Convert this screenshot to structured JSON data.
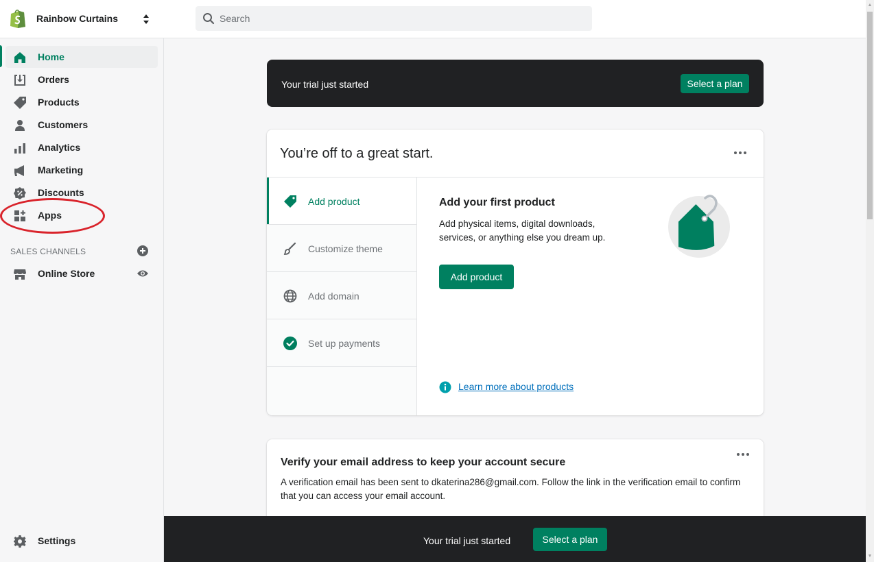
{
  "topbar": {
    "store_name": "Rainbow Curtains",
    "search_placeholder": "Search"
  },
  "sidebar": {
    "items": [
      {
        "label": "Home",
        "icon": "home-icon",
        "active": true
      },
      {
        "label": "Orders",
        "icon": "orders-icon"
      },
      {
        "label": "Products",
        "icon": "tag-icon"
      },
      {
        "label": "Customers",
        "icon": "person-icon"
      },
      {
        "label": "Analytics",
        "icon": "bar-chart-icon"
      },
      {
        "label": "Marketing",
        "icon": "megaphone-icon"
      },
      {
        "label": "Discounts",
        "icon": "discount-icon"
      },
      {
        "label": "Apps",
        "icon": "apps-icon"
      }
    ],
    "sales_channels_title": "SALES CHANNELS",
    "online_store_label": "Online Store",
    "settings_label": "Settings"
  },
  "trial_banner": {
    "text": "Your trial just started",
    "button": "Select a plan"
  },
  "setup_card": {
    "title": "You’re off to a great start.",
    "steps": [
      {
        "label": "Add product",
        "icon": "tag-icon",
        "active": true
      },
      {
        "label": "Customize theme",
        "icon": "brush-icon"
      },
      {
        "label": "Add domain",
        "icon": "globe-icon"
      },
      {
        "label": "Set up payments",
        "icon": "check-circle-icon",
        "done": true
      }
    ],
    "detail_title": "Add your first product",
    "detail_desc": "Add physical items, digital downloads, services, or anything else you dream up.",
    "detail_button": "Add product",
    "learn_more": "Learn more about products"
  },
  "verify_card": {
    "title": "Verify your email address to keep your account secure",
    "desc": "A verification email has been sent to dkaterina286@gmail.com. Follow the link in the verification email to confirm that you can access your email account."
  },
  "bottom_bar": {
    "text": "Your trial just started",
    "button": "Select a plan"
  },
  "colors": {
    "brand_green": "#008060",
    "dark_banner": "#202123",
    "annotation_red": "#d9232b"
  }
}
